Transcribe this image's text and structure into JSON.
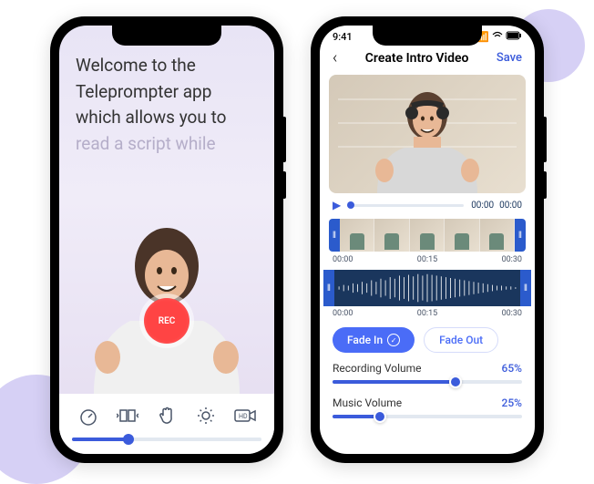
{
  "phone1": {
    "script_line1": "Welcome to the",
    "script_line2": "Teleprompter app",
    "script_line3": "which allows you to",
    "script_line4_faded": "read a script while",
    "rec_label": "REC",
    "toolbar": {
      "speed_icon": "speedometer",
      "mirror_icon": "mirror",
      "gesture_icon": "hand",
      "brightness_icon": "sun",
      "quality_icon": "HD"
    }
  },
  "phone2": {
    "status": {
      "time": "9:41",
      "signal": "●●●●",
      "wifi": "wifi",
      "battery": "100"
    },
    "header": {
      "back": "‹",
      "title": "Create Intro Video",
      "save": "Save"
    },
    "playbar": {
      "t_start": "00:00",
      "t_end": "00:00"
    },
    "filmstrip_times": [
      "00:00",
      "00:15",
      "00:30"
    ],
    "wave_times": [
      "00:00",
      "00:15",
      "00:30"
    ],
    "fade_in_label": "Fade In",
    "fade_out_label": "Fade Out",
    "rec_vol": {
      "label": "Recording Volume",
      "pct": "65%",
      "value": 65
    },
    "music_vol": {
      "label": "Music Volume",
      "pct": "25%",
      "value": 25
    }
  }
}
